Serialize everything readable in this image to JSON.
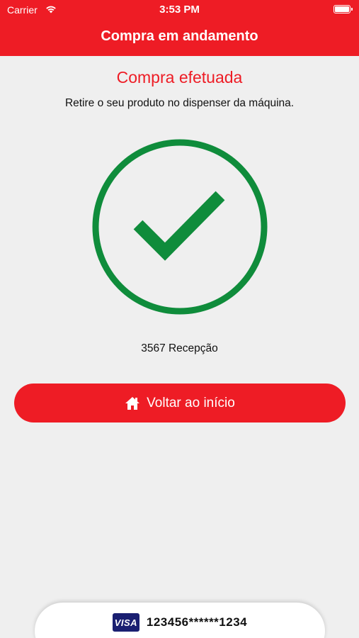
{
  "status_bar": {
    "carrier": "Carrier",
    "time": "3:53 PM",
    "battery_level": 1.0
  },
  "navbar": {
    "title": "Compra em andamento"
  },
  "main": {
    "title": "Compra efetuada",
    "instruction": "Retire o seu produto no dispenser da máquina.",
    "status_icon": "success-check-icon",
    "machine_label": "3567 Recepção",
    "home_button_label": "Voltar ao início",
    "home_button_icon": "home-icon"
  },
  "payment": {
    "card_brand": "VISA",
    "card_number": "123456******1234"
  },
  "colors": {
    "brand_red": "#ee1c25",
    "success_green": "#0f8c3b",
    "visa_blue": "#1a1f71"
  }
}
